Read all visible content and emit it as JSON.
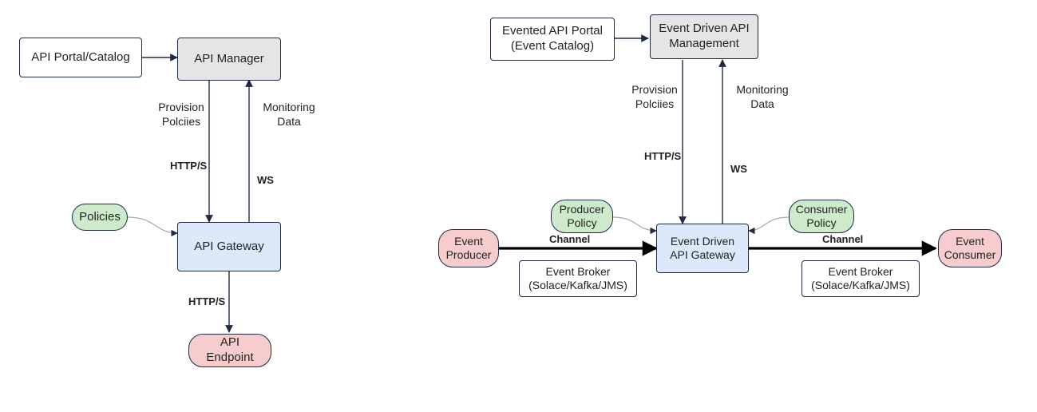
{
  "left": {
    "portal": "API Portal/Catalog",
    "manager": "API Manager",
    "policies": "Policies",
    "gateway": "API Gateway",
    "endpoint": "API Endpoint",
    "provision": "Provision\nPolciies",
    "monitoring": "Monitoring\nData",
    "https1": "HTTP/S",
    "ws": "WS",
    "https2": "HTTP/S"
  },
  "right": {
    "portal": "Evented API Portal\n(Event Catalog)",
    "manager": "Event Driven API\nManagement",
    "producerPolicy": "Producer\nPolicy",
    "consumerPolicy": "Consumer\nPolicy",
    "gateway": "Event Driven\nAPI Gateway",
    "producer": "Event\nProducer",
    "consumer": "Event\nConsumer",
    "broker1": "Event Broker\n(Solace/Kafka/JMS)",
    "broker2": "Event Broker\n(Solace/Kafka/JMS)",
    "provision": "Provision\nPolciies",
    "monitoring": "Monitoring\nData",
    "https1": "HTTP/S",
    "ws": "WS",
    "channel1": "Channel",
    "channel2": "Channel"
  }
}
